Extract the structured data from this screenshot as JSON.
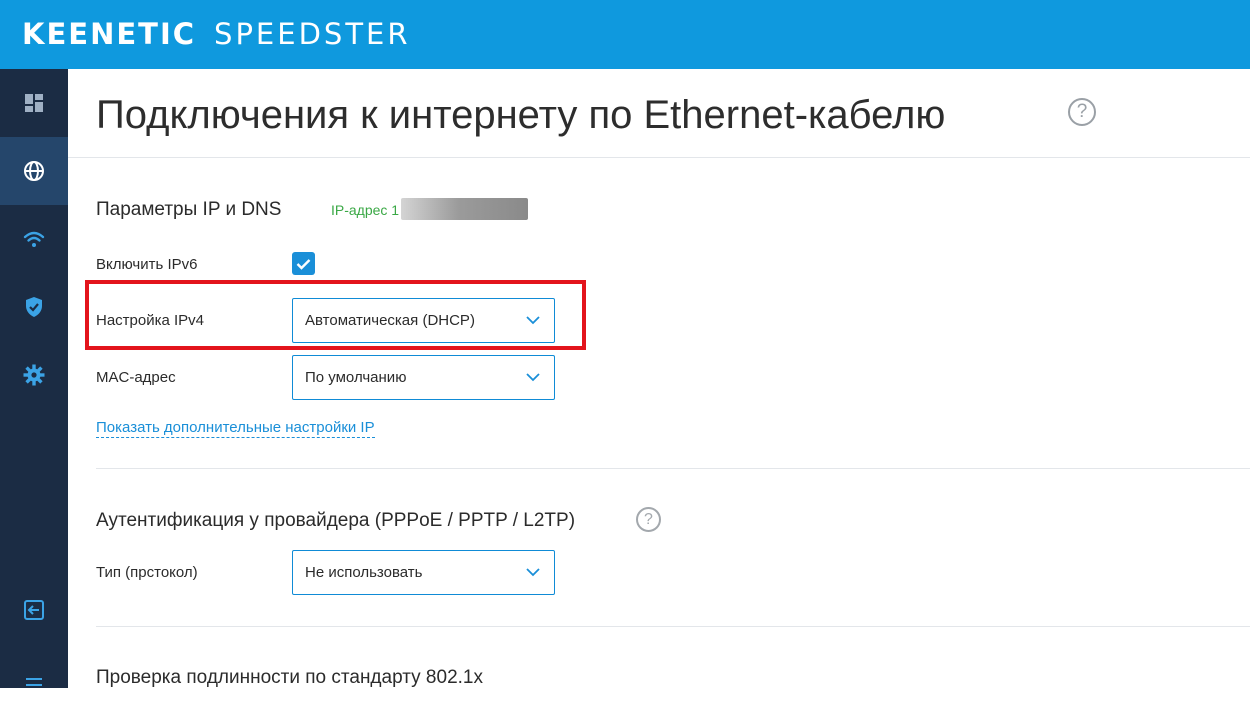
{
  "brand": {
    "part1": "KEENETIC",
    "part2": "SPEEDSTER"
  },
  "sidebar": {
    "items": [
      {
        "name": "dashboard",
        "icon": "dashboard-icon",
        "active": false
      },
      {
        "name": "internet",
        "icon": "globe-icon",
        "active": true
      },
      {
        "name": "wifi",
        "icon": "wifi-icon",
        "active": false
      },
      {
        "name": "security",
        "icon": "shield-icon",
        "active": false
      },
      {
        "name": "settings",
        "icon": "gear-icon",
        "active": false
      }
    ],
    "bottom_items": [
      {
        "name": "logout",
        "icon": "logout-icon"
      },
      {
        "name": "menu",
        "icon": "menu-icon"
      }
    ]
  },
  "header": {
    "title": "Подключения к интернету по Ethernet-кабелю",
    "help": "?"
  },
  "ip_section": {
    "title": "Параметры IP и DNS",
    "ip_label": "IP-адрес 1",
    "ipv6_label": "Включить IPv6",
    "ipv6_enabled": true,
    "ipv4_label": "Настройка IPv4",
    "ipv4_value": "Автоматическая (DHCP)",
    "mac_label": "MAC-адрес",
    "mac_value": "По умолчанию",
    "more_link": "Показать дополнительные настройки IP"
  },
  "auth_section": {
    "title": "Аутентификация у провайдера (PPPoE / PPTP / L2TP)",
    "help": "?",
    "type_label": "Тип (прстокол)",
    "type_value": "Не использовать"
  },
  "dot1x_section": {
    "title": "Проверка подлинности по стандарту 802.1x"
  },
  "colors": {
    "topbar": "#0f99de",
    "sidebar": "#1b2c44",
    "sidebar_active": "#25466b",
    "accent": "#1a8fd8",
    "ip_text": "#3aa845",
    "highlight": "#e3141c"
  }
}
